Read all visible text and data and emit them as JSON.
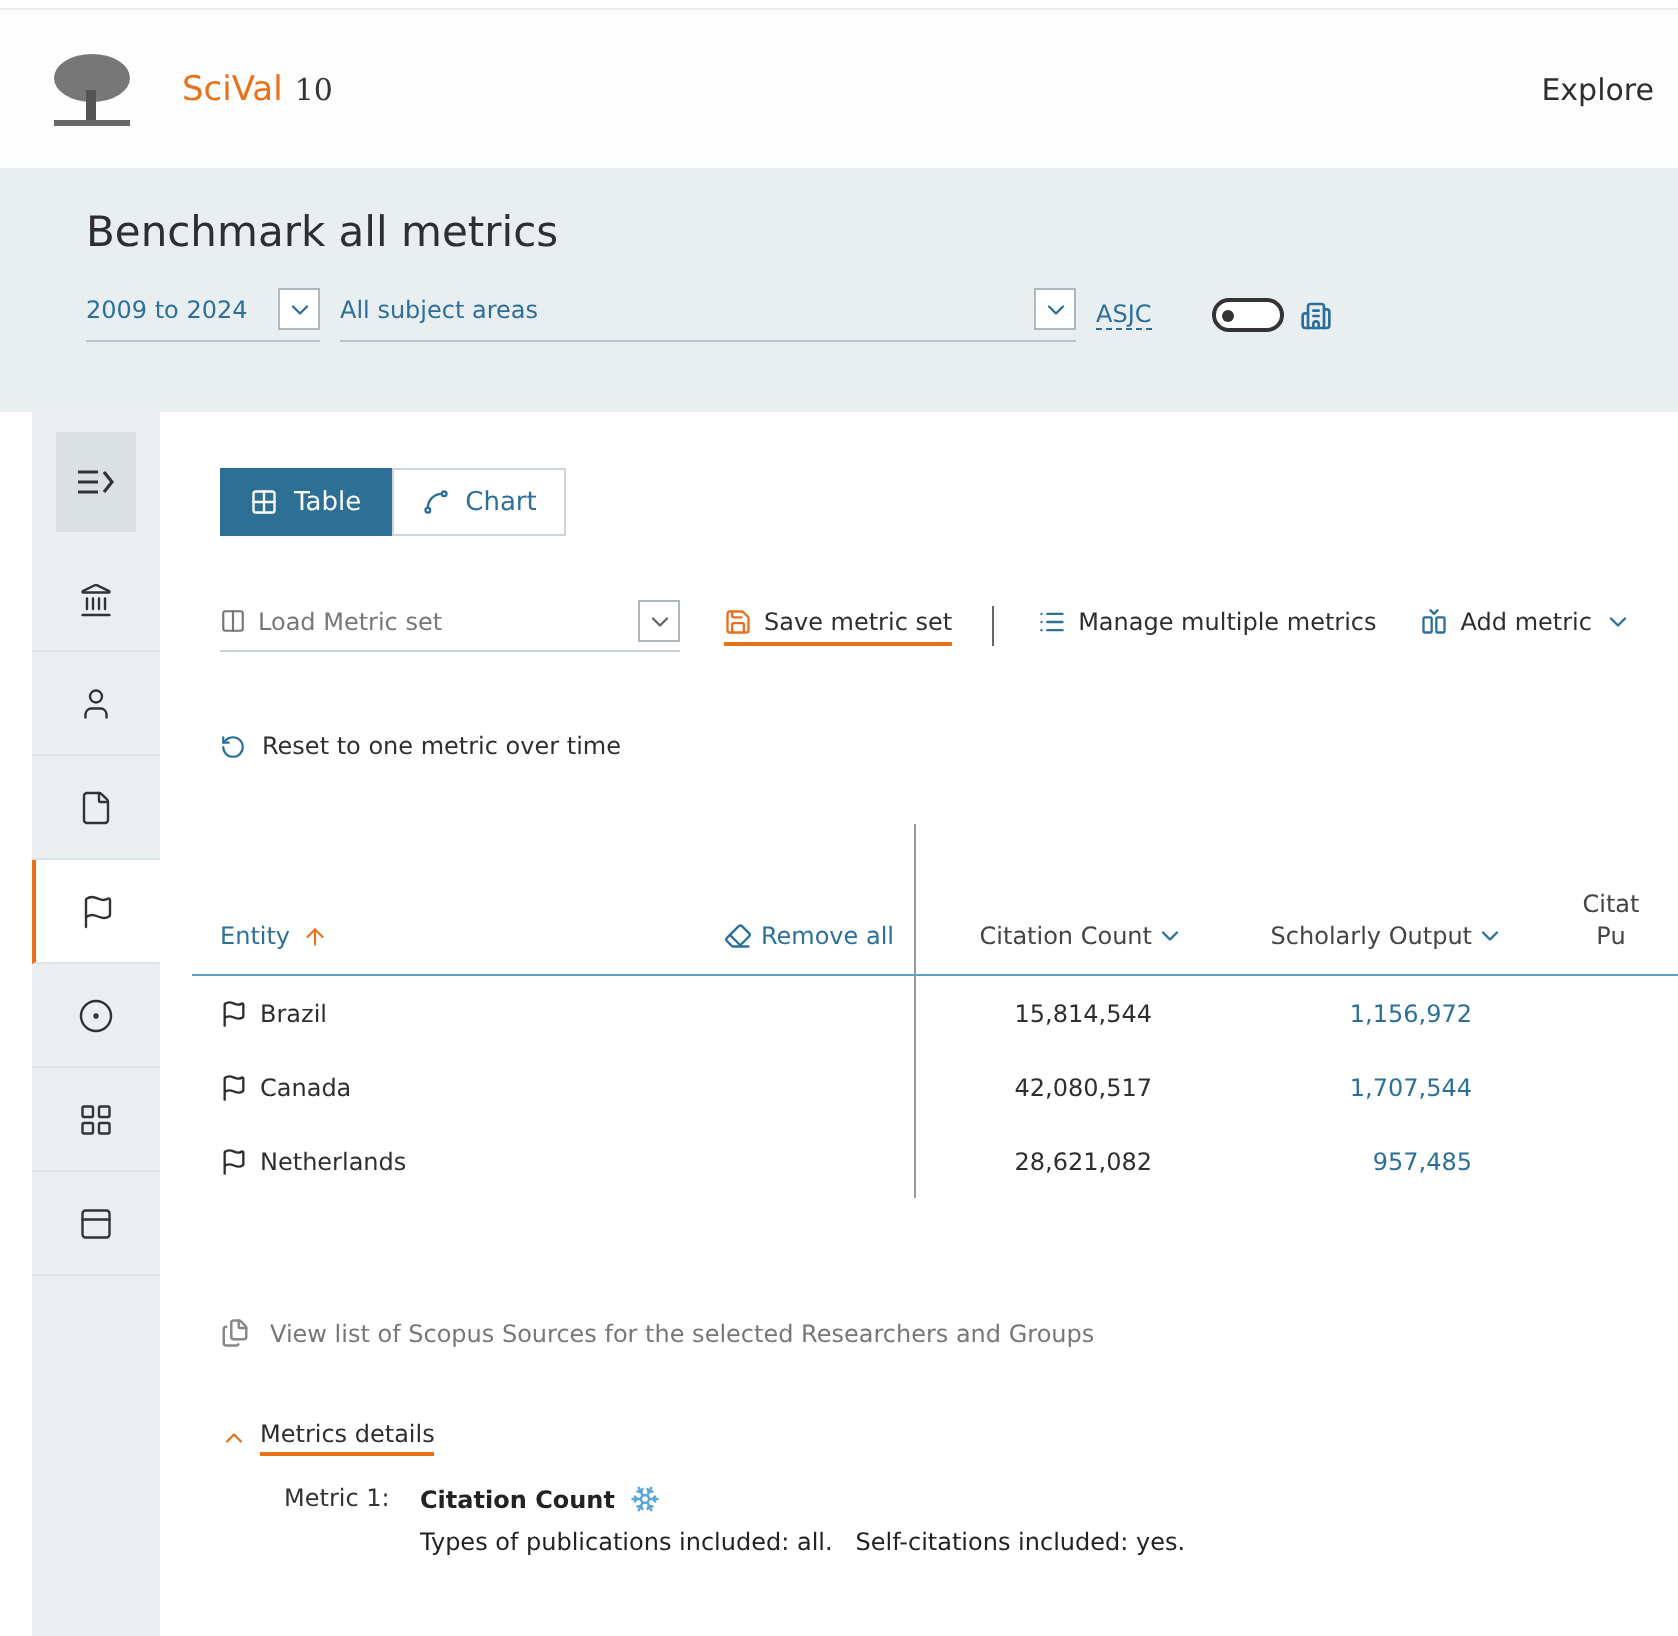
{
  "header": {
    "product": "SciVal",
    "version": "10",
    "nav": [
      "Explore"
    ]
  },
  "page": {
    "title": "Benchmark all metrics",
    "year_range": "2009 to 2024",
    "subject_areas": "All subject areas",
    "classification": "ASJC",
    "toggle": {
      "on": false
    }
  },
  "sidebar": {
    "items": [
      {
        "kind": "menu",
        "selected": false
      },
      {
        "kind": "institution",
        "selected": false
      },
      {
        "kind": "person",
        "selected": false
      },
      {
        "kind": "document",
        "selected": false
      },
      {
        "kind": "flag",
        "selected": true
      },
      {
        "kind": "target",
        "selected": false
      },
      {
        "kind": "grid",
        "selected": false
      },
      {
        "kind": "note",
        "selected": false
      }
    ]
  },
  "view_tabs": [
    {
      "label": "Table",
      "kind": "table",
      "selected": true
    },
    {
      "label": "Chart",
      "kind": "chart",
      "selected": false
    }
  ],
  "toolbar": {
    "metric_set": {
      "placeholder": "Load Metric set"
    },
    "actions": [
      {
        "label": "Save metric set",
        "kind": "save",
        "active": true
      },
      {
        "label": "Manage multiple metrics",
        "kind": "list",
        "active": false
      },
      {
        "label": "Add metric",
        "kind": "add",
        "active": false
      }
    ]
  },
  "reset": "Reset to one metric over time",
  "table": {
    "entity_header": "Entity",
    "remove_all": "Remove all",
    "columns": [
      {
        "lines": [
          "Citation Count"
        ],
        "menu": true
      },
      {
        "lines": [
          "Scholarly Output"
        ],
        "menu": true
      },
      {
        "lines": [
          "Citat",
          "Pu"
        ],
        "menu": false
      }
    ],
    "rows": [
      {
        "entity": "Brazil",
        "cells": [
          {
            "value": "15,814,544",
            "linked": false
          },
          {
            "value": "1,156,972",
            "linked": true
          }
        ]
      },
      {
        "entity": "Canada",
        "cells": [
          {
            "value": "42,080,517",
            "linked": false
          },
          {
            "value": "1,707,544",
            "linked": true
          }
        ]
      },
      {
        "entity": "Netherlands",
        "cells": [
          {
            "value": "28,621,082",
            "linked": false
          },
          {
            "value": "957,485",
            "linked": true
          }
        ]
      }
    ]
  },
  "sources_link": "View list of Scopus Sources for the selected Researchers and Groups",
  "metrics_details": {
    "label": "Metrics details",
    "expanded": true,
    "metrics": [
      {
        "label": "Metric 1:",
        "name": "Citation Count",
        "note": "Types of publications included: all.   Self-citations included: yes."
      }
    ]
  }
}
